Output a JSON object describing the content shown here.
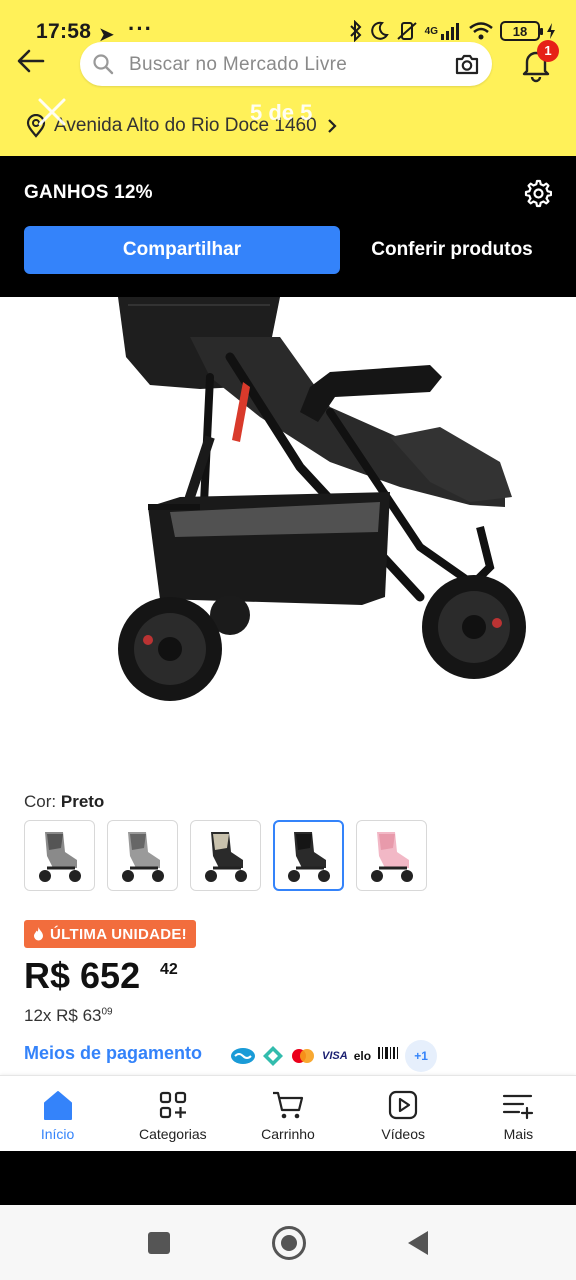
{
  "status_bar": {
    "time": "17:58",
    "send_icon": "➤",
    "dots": "···",
    "network": "4G",
    "battery": "18"
  },
  "header": {
    "search_placeholder": "Buscar no Mercado Livre",
    "notification_count": "1",
    "address": "Avenida Alto do Rio Doce 1460",
    "image_counter": "5 de 5"
  },
  "earn_bar": {
    "label": "GANHOS 12%",
    "share_button": "Compartilhar",
    "check_products_button": "Conferir produtos"
  },
  "product": {
    "color_label": "Cor:",
    "color_value": "Preto",
    "variants": [
      {
        "tone": "gray",
        "selected": false
      },
      {
        "tone": "gray",
        "selected": false
      },
      {
        "tone": "beige",
        "selected": false
      },
      {
        "tone": "black",
        "selected": true
      },
      {
        "tone": "pink",
        "selected": false
      }
    ],
    "badge": "ÚLTIMA UNIDADE!",
    "price_main": "R$ 652",
    "price_cents": "42",
    "installments_prefix": "12x R$ 63",
    "installments_cents": "09",
    "payment_link": "Meios de pagamento",
    "payment_more": "+1",
    "payment_methods": [
      "Mercado Pago",
      "Pix",
      "Mastercard",
      "VISA",
      "elo",
      "Boleto"
    ]
  },
  "bottom_nav": [
    {
      "label": "Início",
      "icon": "home-icon",
      "active": true
    },
    {
      "label": "Categorias",
      "icon": "categories-icon",
      "active": false
    },
    {
      "label": "Carrinho",
      "icon": "cart-icon",
      "active": false
    },
    {
      "label": "Vídeos",
      "icon": "video-icon",
      "active": false
    },
    {
      "label": "Mais",
      "icon": "more-icon",
      "active": false
    }
  ],
  "colors": {
    "brand_yellow": "#fff159",
    "accent_blue": "#3483fa",
    "badge_orange": "#f26d3d",
    "notification_red": "#e62117"
  }
}
